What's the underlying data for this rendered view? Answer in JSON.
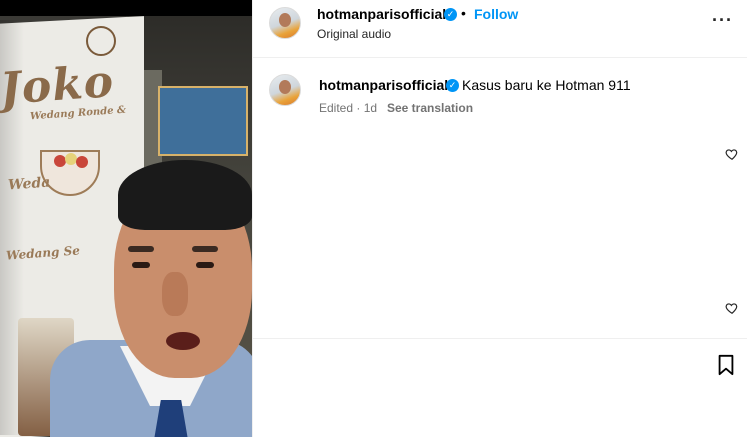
{
  "header": {
    "username": "hotmanparisofficial",
    "verified_mark": "✓",
    "separator": "•",
    "follow_label": "Follow",
    "audio_label": "Original audio",
    "more_icon": "more-horizontal-icon",
    "more_glyph": "···"
  },
  "caption": {
    "username": "hotmanparisofficial",
    "verified_mark": "✓",
    "text": "Kasus baru ke Hotman 911",
    "edited": "Edited",
    "separator": "·",
    "age": "1d",
    "translate_label": "See translation"
  },
  "media": {
    "banner_text_1": "Joko",
    "banner_text_2": "Wedang Ronde &",
    "banner_text_3": "Weda",
    "banner_text_4": "Wedang Se"
  },
  "colors": {
    "accent": "#0095f6",
    "secondary_text": "#737373",
    "divider": "#efefef"
  },
  "icons": [
    "heart-icon",
    "heart-icon",
    "bookmark-icon",
    "verified-badge-icon",
    "more-horizontal-icon"
  ]
}
